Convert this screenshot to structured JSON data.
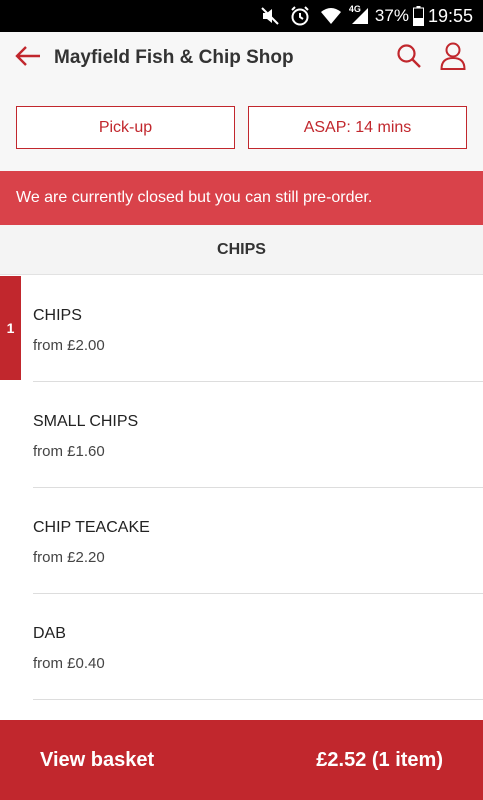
{
  "status_bar": {
    "icons": [
      "mute-vibrate-icon",
      "alarm-icon",
      "wifi-icon",
      "signal-4g-icon",
      "battery-icon"
    ],
    "network_label": "4G",
    "battery": "37%",
    "time": "19:55"
  },
  "header": {
    "title": "Mayfield Fish & Chip Shop",
    "back_icon": "arrow-left-icon",
    "search_icon": "search-icon",
    "account_icon": "user-icon"
  },
  "order_options": {
    "mode_label": "Pick-up",
    "time_label": "ASAP: 14 mins"
  },
  "notice": {
    "text": "We are currently closed but you can still pre-order."
  },
  "menu": {
    "section_title": "CHIPS",
    "items": [
      {
        "name": "CHIPS",
        "price": "from £2.00",
        "quantity": "1"
      },
      {
        "name": "SMALL CHIPS",
        "price": "from £1.60"
      },
      {
        "name": "CHIP TEACAKE",
        "price": "from £2.20"
      },
      {
        "name": "DAB",
        "price": "from £0.40"
      }
    ]
  },
  "basket": {
    "label": "View basket",
    "total": "£2.52 (1 item)"
  },
  "colors": {
    "brand": "#c1272d",
    "notice_bg": "#d9424a",
    "header_bg": "#f7f7f7",
    "status_bar_bg": "#000000"
  }
}
